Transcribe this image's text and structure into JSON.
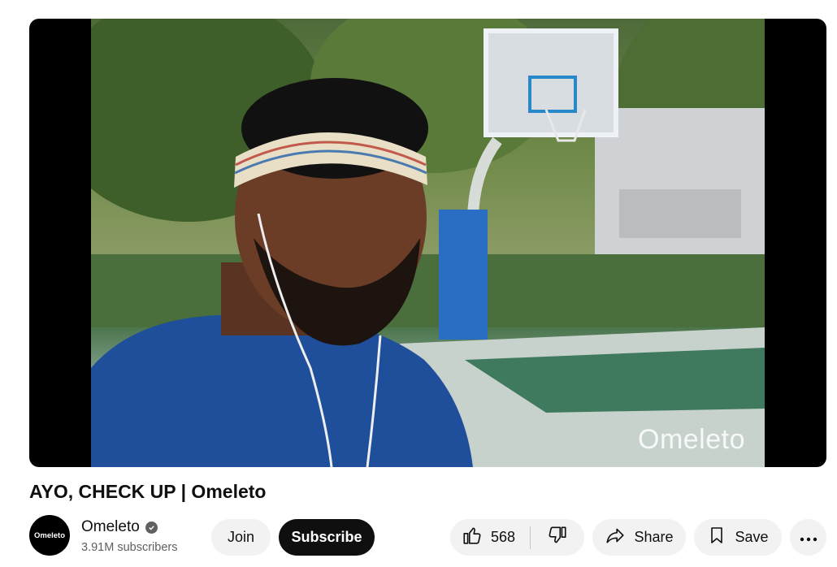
{
  "video": {
    "watermark": "Omeleto"
  },
  "title": "AYO, CHECK UP | Omeleto",
  "channel": {
    "avatar_text": "Omeleto",
    "name": "Omeleto",
    "subscribers": "3.91M subscribers",
    "verified": true
  },
  "actions": {
    "join": "Join",
    "subscribe": "Subscribe",
    "like_count": "568",
    "share": "Share",
    "save": "Save"
  },
  "icons": [
    "verified-check-icon",
    "thumbs-up-icon",
    "thumbs-down-icon",
    "share-arrow-icon",
    "bookmark-icon",
    "more-horizontal-icon"
  ]
}
